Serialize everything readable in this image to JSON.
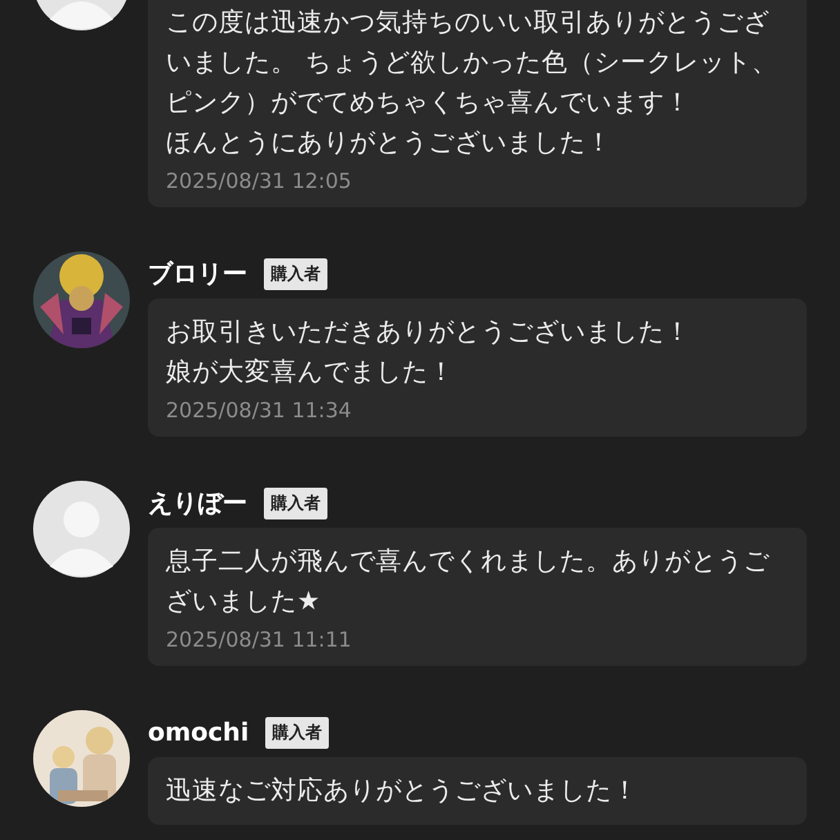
{
  "comments": [
    {
      "avatar": {
        "kind": "default"
      },
      "text": [
        "この度は迅速かつ気持ちのいい取引ありがとうございました。 ちょうど欲しかった色（シークレット、ピンク）がでてめちゃくちゃ喜んでいます！",
        "ほんとうにありがとうございました！"
      ],
      "date": "2025/08/31 12:05"
    },
    {
      "name": "ブロリー",
      "badge": "購入者",
      "avatar": {
        "kind": "picture"
      },
      "text": [
        "お取引きいただきありがとうございました！",
        "娘が大変喜んでました！"
      ],
      "date": "2025/08/31 11:34"
    },
    {
      "name": "えりぼー",
      "badge": "購入者",
      "avatar": {
        "kind": "default"
      },
      "text": [
        "息子二人が飛んで喜んでくれました。ありがとうございました★"
      ],
      "date": "2025/08/31 11:11"
    },
    {
      "name": "omochi",
      "badge": "購入者",
      "avatar": {
        "kind": "picture"
      },
      "text": [
        "迅速なご対応ありがとうございました！"
      ]
    }
  ]
}
